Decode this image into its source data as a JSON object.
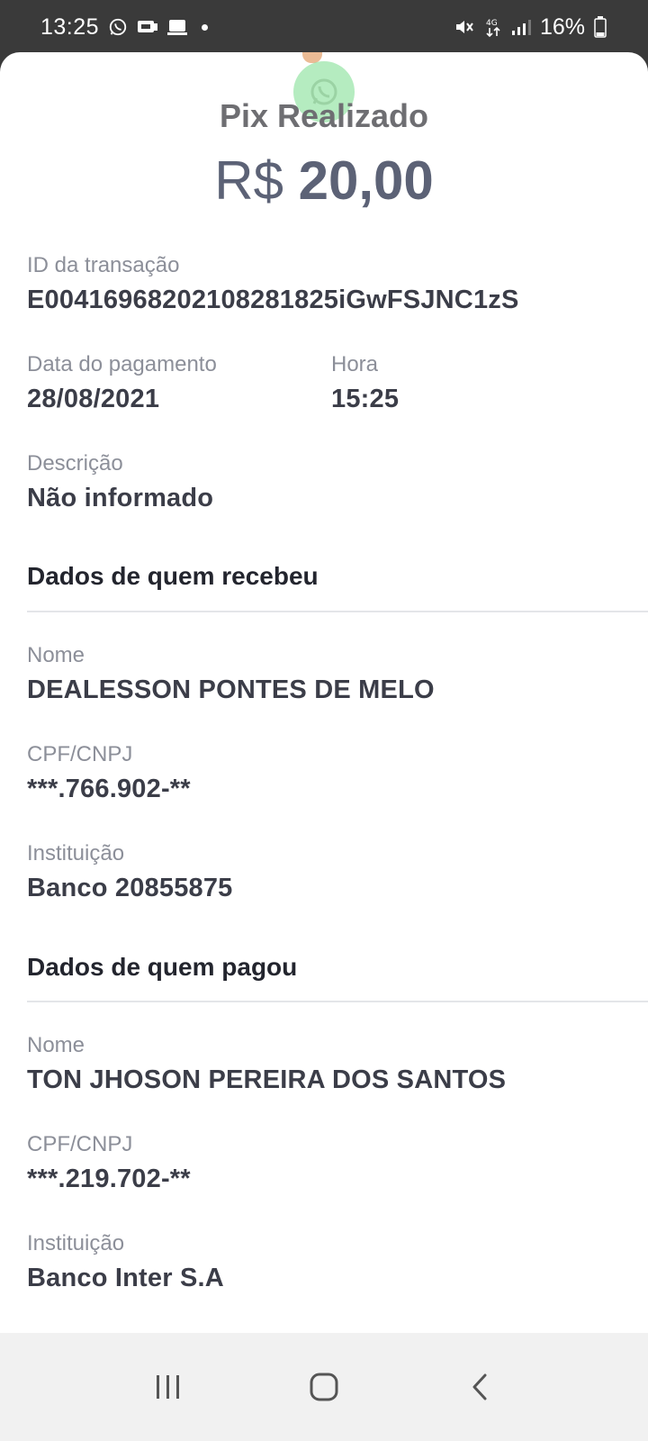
{
  "status_bar": {
    "time": "13:25",
    "battery": "16%",
    "icons": [
      "whatsapp-icon",
      "notification-icon",
      "media-icon",
      "dot-icon",
      "mute-icon",
      "4g-icon",
      "signal-icon",
      "battery-icon"
    ]
  },
  "receipt": {
    "title": "Pix Realizado",
    "currency": "R$",
    "amount": "20,00"
  },
  "transaction": {
    "id_label": "ID da transação",
    "id_value": "E00416968202108281825iGwFSJNC1zS",
    "date_label": "Data do pagamento",
    "date_value": "28/08/2021",
    "time_label": "Hora",
    "time_value": "15:25",
    "desc_label": "Descrição",
    "desc_value": "Não informado"
  },
  "receiver": {
    "section_title": "Dados de quem recebeu",
    "name_label": "Nome",
    "name_value": "DEALESSON PONTES DE MELO",
    "doc_label": "CPF/CNPJ",
    "doc_value": "***.766.902-**",
    "inst_label": "Instituição",
    "inst_value": "Banco 20855875"
  },
  "payer": {
    "section_title": "Dados de quem pagou",
    "name_label": "Nome",
    "name_value": "TON JHOSON PEREIRA DOS SANTOS",
    "doc_label": "CPF/CNPJ",
    "doc_value": "***.219.702-**",
    "inst_label": "Instituição",
    "inst_value": "Banco Inter S.A"
  },
  "nav": [
    "recent-apps-icon",
    "home-icon",
    "back-icon"
  ]
}
